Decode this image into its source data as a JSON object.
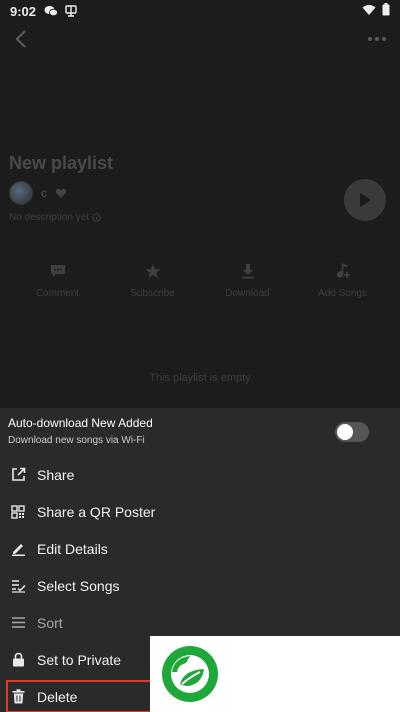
{
  "status_bar": {
    "time": "9:02"
  },
  "playlist": {
    "title": "New playlist",
    "owner": "c",
    "description": "No description yet"
  },
  "actions": [
    {
      "label": "Comment",
      "icon": "comment-icon"
    },
    {
      "label": "Subscribe",
      "icon": "star-icon"
    },
    {
      "label": "Download",
      "icon": "download-icon"
    },
    {
      "label": "Add Songs",
      "icon": "add-music-icon"
    }
  ],
  "empty_text": "This playlist is empty",
  "sheet": {
    "auto_download": {
      "title": "Auto-download New Added",
      "subtitle": "Download new songs via Wi-Fi",
      "enabled": false
    },
    "items": [
      {
        "label": "Share",
        "icon": "share-icon"
      },
      {
        "label": "Share a QR Poster",
        "icon": "qr-code-icon"
      },
      {
        "label": "Edit Details",
        "icon": "pencil-icon"
      },
      {
        "label": "Select Songs",
        "icon": "select-list-icon"
      },
      {
        "label": "Sort",
        "icon": "sort-icon"
      },
      {
        "label": "Set to Private",
        "icon": "lock-icon"
      },
      {
        "label": "Delete",
        "icon": "trash-icon"
      }
    ]
  },
  "colors": {
    "highlight": "#e03a2a",
    "logo_green": "#1fa83a"
  }
}
